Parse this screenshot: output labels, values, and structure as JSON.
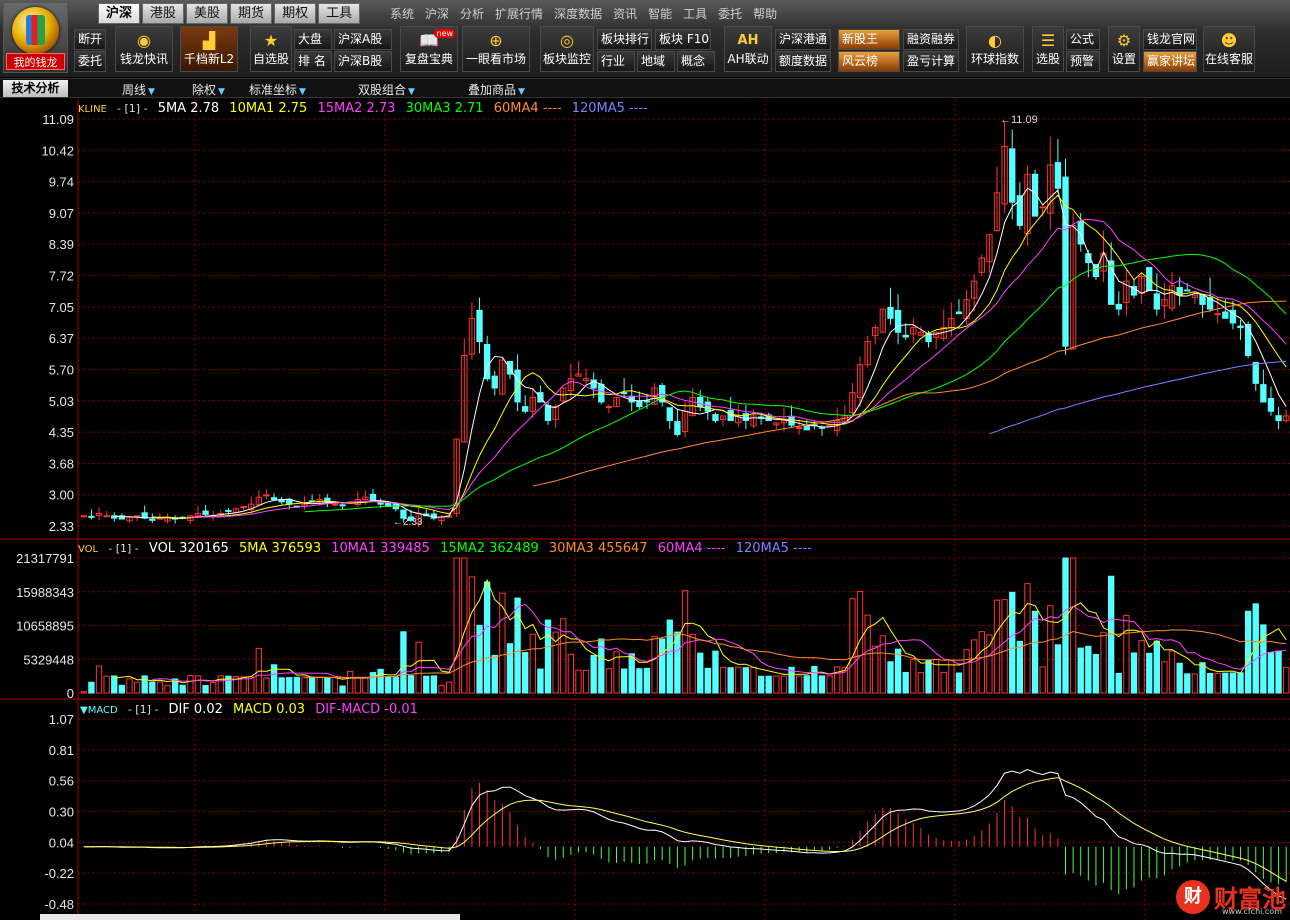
{
  "logo": {
    "label": "我的钱龙"
  },
  "menu_tabs": [
    "沪深",
    "港股",
    "美股",
    "期货",
    "期权",
    "工具"
  ],
  "menu_items": [
    "系统",
    "沪深",
    "分析",
    "扩展行情",
    "深度数据",
    "资讯",
    "智能",
    "工具",
    "委托",
    "帮助"
  ],
  "toolbar": {
    "duankai": "断开",
    "weituo": "委托",
    "kuaixun": "钱龙快讯",
    "qiandang": "千档新L2",
    "zixuan": "自选股",
    "dapan": "大盘",
    "hushen_a": "沪深A股",
    "paiming": "排 名",
    "hushen_b": "沪深B股",
    "fupan": "复盘宝典",
    "fupan_badge": "new",
    "yiyan": "一眼看市场",
    "bankuai_jiankong": "板块监控",
    "bankuai_paihang": "板块排行",
    "bankuai_f10": "板块 F10",
    "hangye": "行业",
    "diyu": "地域",
    "gainian": "概念",
    "ah": "AH联动",
    "hushen_gangtong": "沪深港通",
    "edu": "额度数据",
    "xingu": "新股王",
    "rongzi": "融资融券",
    "fengyun": "风云榜",
    "yingkui": "盈亏计算",
    "huanqiu": "环球指数",
    "xuangu": "选股",
    "gongshi": "公式",
    "yujing": "预警",
    "shezhi": "设置",
    "guanwang": "钱龙官网",
    "yingjia": "赢家讲坛",
    "kefu": "在线客服"
  },
  "subbar": {
    "tech": "技术分析",
    "zhouxian": "周线",
    "chuquan": "除权",
    "zuobiao": "标准坐标",
    "shuanggu": "双股组合",
    "diejia": "叠加商品"
  },
  "kline_legend": {
    "name": "KLINE",
    "sep": "- [1] -",
    "ma5": "5MA 2.78",
    "ma10": "10MA1 2.75",
    "ma15": "15MA2 2.73",
    "ma30": "30MA3 2.71",
    "ma60": "60MA4 ----",
    "ma120": "120MA5 ----"
  },
  "vol_legend": {
    "name": "VOL",
    "sep": "- [1] -",
    "vol": "VOL 320165",
    "ma5": "5MA 376593",
    "ma10": "10MA1 339485",
    "ma15": "15MA2 362489",
    "ma30": "30MA3 455647",
    "ma60": "60MA4 ----",
    "ma120": "120MA5 ----"
  },
  "macd_legend": {
    "name": "▼MACD",
    "sep": "- [1] -",
    "dif": "DIF 0.02",
    "macd": "MACD 0.03",
    "difmacd": "DIF-MACD -0.01"
  },
  "price_labels": {
    "high": "11.09",
    "low": "2.33"
  },
  "watermark": {
    "char": "财",
    "text": "财富池",
    "url": "www.cfchi.com"
  },
  "colors": {
    "up": "#ff3232",
    "down": "#54ffff",
    "ma5": "#ffffff",
    "ma10": "#ffff00",
    "ma15": "#ff40ff",
    "ma30": "#00ff00",
    "ma60": "#ff8c28",
    "ma120": "#8080ff",
    "dif": "#ffffff",
    "dea": "#ffff60",
    "grid": "#8b0000"
  },
  "chart_data": {
    "type": "candlestick",
    "panels": [
      {
        "name": "KLINE",
        "y_ticks": [
          "11.09",
          "10.42",
          "9.74",
          "9.07",
          "8.39",
          "7.72",
          "7.05",
          "6.37",
          "5.70",
          "5.03",
          "4.35",
          "3.68",
          "3.00",
          "2.33"
        ],
        "ylim": [
          2.33,
          11.09
        ]
      },
      {
        "name": "VOL",
        "y_ticks": [
          "21317791",
          "15988343",
          "10658895",
          "5329448",
          "0"
        ],
        "ylim": [
          0,
          21317791
        ]
      },
      {
        "name": "MACD",
        "y_ticks": [
          "1.07",
          "0.81",
          "0.56",
          "0.30",
          "0.04",
          "-0.22",
          "-0.48"
        ],
        "ylim": [
          -0.48,
          1.07
        ]
      }
    ],
    "close": [
      2.55,
      2.52,
      2.6,
      2.55,
      2.5,
      2.48,
      2.52,
      2.55,
      2.5,
      2.47,
      2.5,
      2.52,
      2.48,
      2.5,
      2.55,
      2.6,
      2.58,
      2.55,
      2.6,
      2.65,
      2.7,
      2.75,
      2.8,
      2.95,
      3.0,
      2.9,
      2.85,
      2.8,
      2.75,
      2.8,
      2.85,
      2.9,
      2.85,
      2.8,
      2.78,
      2.85,
      2.9,
      2.95,
      2.88,
      2.8,
      2.75,
      2.7,
      2.5,
      2.45,
      2.6,
      2.55,
      2.5,
      2.52,
      2.55,
      4.2,
      6.0,
      6.8,
      6.3,
      5.5,
      5.3,
      5.9,
      5.6,
      5.0,
      4.8,
      5.1,
      5.0,
      4.6,
      4.9,
      5.3,
      5.5,
      5.6,
      5.5,
      5.3,
      5.0,
      4.9,
      5.1,
      5.2,
      5.0,
      4.9,
      5.0,
      5.3,
      5.0,
      4.6,
      4.3,
      4.8,
      5.1,
      4.9,
      4.8,
      4.6,
      4.7,
      4.6,
      4.7,
      4.6,
      4.7,
      4.65,
      4.6,
      4.55,
      4.6,
      4.5,
      4.45,
      4.4,
      4.5,
      4.45,
      4.5,
      4.6,
      4.7,
      5.2,
      5.8,
      6.3,
      6.6,
      7.0,
      6.8,
      6.5,
      6.4,
      6.6,
      6.5,
      6.3,
      6.5,
      6.6,
      6.8,
      6.9,
      7.2,
      7.6,
      8.1,
      8.6,
      9.5,
      10.5,
      9.3,
      8.8,
      9.9,
      9.0,
      9.2,
      10.1,
      9.6,
      6.2,
      8.8,
      8.4,
      8.0,
      7.7,
      8.2,
      7.1,
      7.0,
      7.6,
      7.3,
      7.7,
      7.4,
      7.0,
      7.2,
      7.5,
      7.3,
      7.4,
      7.3,
      7.1,
      7.0,
      6.9,
      6.8,
      6.7,
      6.6,
      6.0,
      5.4,
      5.0,
      4.8,
      4.6,
      4.7
    ],
    "macd_dif_start": 0.0,
    "macd_labels": {
      "dif": "DIF",
      "dea": "MACD"
    }
  }
}
